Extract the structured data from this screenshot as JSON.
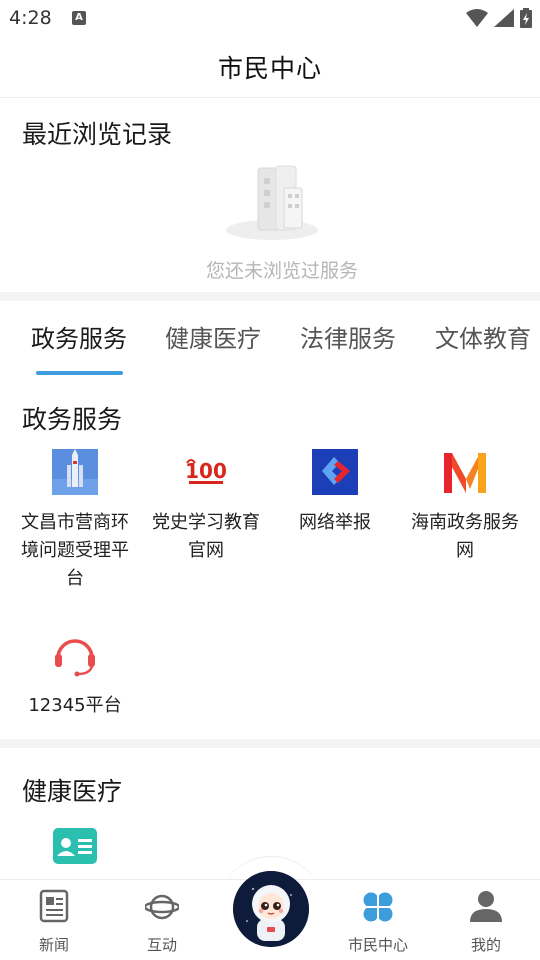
{
  "status": {
    "time": "4:28",
    "notification_badge": "A"
  },
  "header": {
    "title": "市民中心"
  },
  "recent": {
    "title": "最近浏览记录",
    "empty_text": "您还未浏览过服务"
  },
  "tabs": [
    {
      "label": "政务服务",
      "active": true
    },
    {
      "label": "健康医疗",
      "active": false
    },
    {
      "label": "法律服务",
      "active": false
    },
    {
      "label": "文体教育",
      "active": false
    }
  ],
  "gov_section": {
    "title": "政务服务",
    "items": [
      {
        "label": "文昌市营商环境问题受理平台",
        "icon": "rocket-icon"
      },
      {
        "label": "党史学习教育官网",
        "icon": "party-history-100-icon"
      },
      {
        "label": "网络举报",
        "icon": "report-logo-icon"
      },
      {
        "label": "海南政务服务网",
        "icon": "hainan-m-logo-icon"
      },
      {
        "label": "12345平台",
        "icon": "headset-icon"
      }
    ]
  },
  "health_section": {
    "title": "健康医疗",
    "items": [
      {
        "icon": "id-card-icon"
      }
    ]
  },
  "bottom_nav": [
    {
      "label": "新闻",
      "icon": "news-icon",
      "active": false
    },
    {
      "label": "互动",
      "icon": "planet-icon",
      "active": false
    },
    {
      "label": "",
      "icon": "astronaut-mascot-icon",
      "active": false
    },
    {
      "label": "市民中心",
      "icon": "clover-icon",
      "active": true
    },
    {
      "label": "我的",
      "icon": "person-icon",
      "active": false
    }
  ],
  "colors": {
    "accent": "#3d9cdc",
    "divider": "#f2f3f5",
    "nav_active": "#2f8fd6"
  }
}
